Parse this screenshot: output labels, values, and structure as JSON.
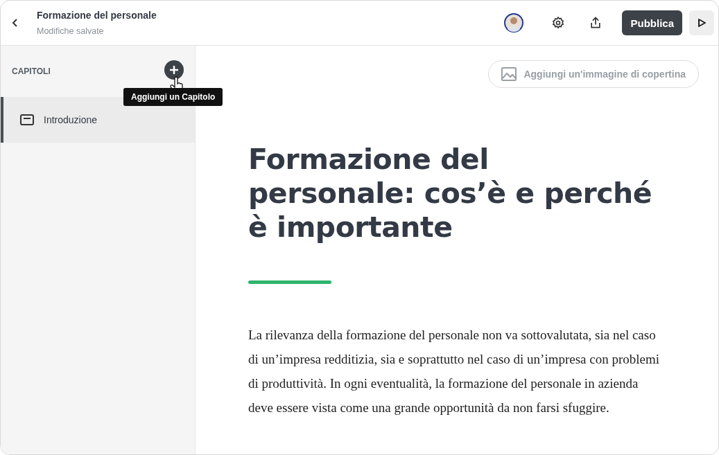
{
  "header": {
    "title": "Formazione del personale",
    "status": "Modifiche salvate",
    "publish_button": "Pubblica"
  },
  "sidebar": {
    "heading": "CAPITOLI",
    "tooltip": "Aggiungi un Capitolo",
    "chapters": [
      {
        "label": "Introduzione",
        "selected": true
      }
    ]
  },
  "editor": {
    "cover_button": "Aggiungi un'immagine di copertina",
    "title": "Formazione del personale: cos’è e perché è importante",
    "paragraph": "La rilevanza della formazione del personale non va sottovalutata, sia nel caso di un’impresa redditizia, sia e soprattutto nel caso di un’impresa con problemi di produttività. In ogni eventualità, la formazione del personale in azienda deve essere vista come una grande opportunità da non farsi sfuggire."
  }
}
